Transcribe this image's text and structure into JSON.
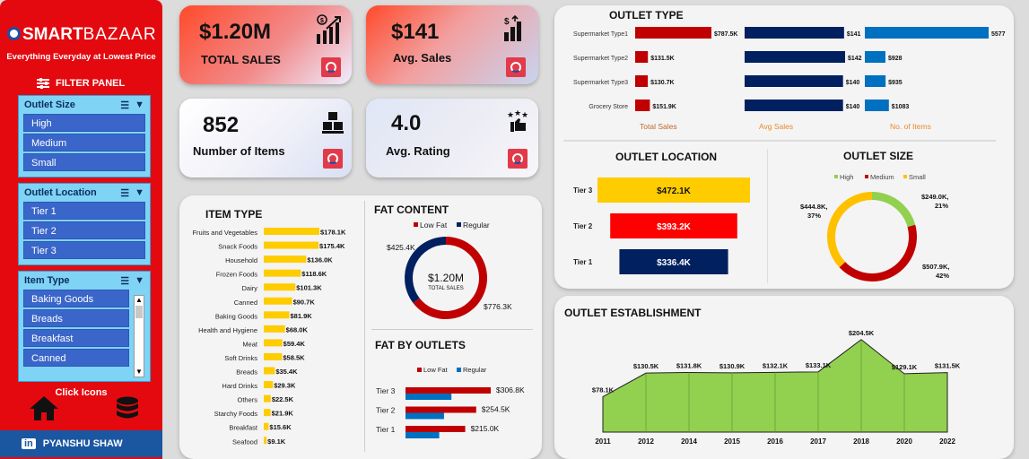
{
  "sidebar": {
    "logo_brand": "SMART",
    "logo_suffix": "BAZAAR",
    "tagline": "Everything Everyday at Lowest Price",
    "filter_label": "FILTER PANEL",
    "slicers": [
      {
        "title": "Outlet Size",
        "items": [
          "High",
          "Medium",
          "Small"
        ]
      },
      {
        "title": "Outlet Location",
        "items": [
          "Tier 1",
          "Tier 2",
          "Tier 3"
        ]
      },
      {
        "title": "Item Type",
        "items": [
          "Baking Goods",
          "Breads",
          "Breakfast",
          "Canned"
        ]
      }
    ],
    "click_icons_label": "Click Icons",
    "author": "PYANSHU SHAW",
    "author_badge": "in"
  },
  "kpis": {
    "total_sales": {
      "value": "$1.20M",
      "label": "TOTAL SALES"
    },
    "avg_sales": {
      "value": "$141",
      "label": "Avg. Sales"
    },
    "num_items": {
      "value": "852",
      "label": "Number of Items"
    },
    "avg_rating": {
      "value": "4.0",
      "label": "Avg. Rating"
    }
  },
  "colors": {
    "red": "#c00000",
    "navy": "#002060",
    "blue": "#0070c0",
    "yellow": "#ffcc00",
    "green": "#92d050",
    "high": "#92d050",
    "medium": "#c00000",
    "small": "#ffc000"
  },
  "chart_data": [
    {
      "type": "bar",
      "title": "ITEM TYPE",
      "categories": [
        "Fruits and Vegetables",
        "Snack Foods",
        "Household",
        "Frozen Foods",
        "Dairy",
        "Canned",
        "Baking Goods",
        "Health and Hygiene",
        "Meat",
        "Soft Drinks",
        "Breads",
        "Hard Drinks",
        "Others",
        "Starchy Foods",
        "Breakfast",
        "Seafood"
      ],
      "values": [
        178.1,
        175.4,
        136.0,
        118.6,
        101.3,
        90.7,
        81.9,
        68.0,
        59.4,
        58.5,
        35.4,
        29.3,
        22.5,
        21.9,
        15.6,
        9.1
      ],
      "labels": [
        "$178.1K",
        "$175.4K",
        "$136.0K",
        "$118.6K",
        "$101.3K",
        "$90.7K",
        "$81.9K",
        "$68.0K",
        "$59.4K",
        "$58.5K",
        "$35.4K",
        "$29.3K",
        "$22.5K",
        "$21.9K",
        "$15.6K",
        "$9.1K"
      ]
    },
    {
      "type": "pie",
      "title": "FAT CONTENT",
      "categories": [
        "Low Fat",
        "Regular"
      ],
      "values": [
        776.3,
        425.4
      ],
      "labels": [
        "$776.3K",
        "$425.4K"
      ],
      "center_value": "$1.20M",
      "center_label": "TOTAL SALES"
    },
    {
      "type": "bar",
      "title": "FAT BY OUTLETS",
      "categories": [
        "Tier 3",
        "Tier 2",
        "Tier 1"
      ],
      "series": [
        {
          "name": "Low Fat",
          "values": [
            306.8,
            254.5,
            215.0
          ]
        },
        {
          "name": "Regular",
          "values": [
            165.3,
            138.7,
            121.4
          ]
        }
      ],
      "labels": [
        "$306.8K",
        "$254.5K",
        "$215.0K"
      ]
    },
    {
      "type": "bar",
      "title": "OUTLET TYPE",
      "categories": [
        "Supermarket Type1",
        "Supermarket Type2",
        "Supermarket Type3",
        "Grocery Store"
      ],
      "series": [
        {
          "name": "Total Sales",
          "values": [
            787.5,
            131.5,
            130.7,
            151.9
          ],
          "labels": [
            "$787.5K",
            "$131.5K",
            "$130.7K",
            "$151.9K"
          ]
        },
        {
          "name": "Avg Sales",
          "values": [
            141,
            142,
            140,
            140
          ],
          "labels": [
            "$141",
            "$142",
            "$140",
            "$140"
          ]
        },
        {
          "name": "No. of Items",
          "values": [
            5577,
            928,
            935,
            1083
          ],
          "labels": [
            "5577",
            "$928",
            "$935",
            "$1083"
          ]
        }
      ]
    },
    {
      "type": "bar",
      "title": "OUTLET LOCATION",
      "categories": [
        "Tier 3",
        "Tier 2",
        "Tier 1"
      ],
      "values": [
        472.1,
        393.2,
        336.4
      ],
      "labels": [
        "$472.1K",
        "$393.2K",
        "$336.4K"
      ]
    },
    {
      "type": "pie",
      "title": "OUTLET SIZE",
      "categories": [
        "High",
        "Medium",
        "Small"
      ],
      "values": [
        249.0,
        507.9,
        444.8
      ],
      "labels": [
        "$249.0K,\n21%",
        "$507.9K,\n42%",
        "$444.8K,\n37%"
      ]
    },
    {
      "type": "area",
      "title": "OUTLET ESTABLISHMENT",
      "x": [
        "2011",
        "2012",
        "2014",
        "2015",
        "2016",
        "2017",
        "2018",
        "2020",
        "2022"
      ],
      "values": [
        78.1,
        130.5,
        131.8,
        130.9,
        132.1,
        133.1,
        204.5,
        129.1,
        131.5
      ],
      "labels": [
        "$78.1K",
        "$130.5K",
        "$131.8K",
        "$130.9K",
        "$132.1K",
        "$133.1K",
        "$204.5K",
        "$129.1K",
        "$131.5K"
      ]
    }
  ]
}
